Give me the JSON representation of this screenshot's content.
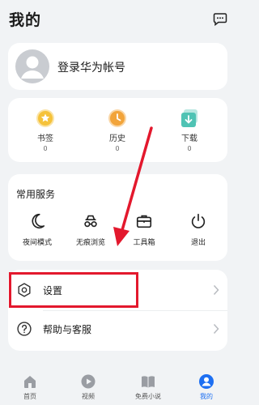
{
  "header": {
    "title": "我的"
  },
  "account": {
    "login_label": "登录华为帐号"
  },
  "stats": [
    {
      "label": "书签",
      "count": "0",
      "icon": "star-icon"
    },
    {
      "label": "历史",
      "count": "0",
      "icon": "clock-icon"
    },
    {
      "label": "下载",
      "count": "0",
      "icon": "download-icon"
    }
  ],
  "services": {
    "title": "常用服务",
    "items": [
      {
        "label": "夜间模式",
        "icon": "moon-icon"
      },
      {
        "label": "无痕浏览",
        "icon": "incognito-icon"
      },
      {
        "label": "工具箱",
        "icon": "toolbox-icon"
      },
      {
        "label": "退出",
        "icon": "power-icon"
      }
    ]
  },
  "menu": [
    {
      "label": "设置",
      "icon": "gear-icon"
    },
    {
      "label": "帮助与客服",
      "icon": "help-icon"
    }
  ],
  "tabs": [
    {
      "label": "首页",
      "icon": "home-icon",
      "active": false
    },
    {
      "label": "视频",
      "icon": "video-icon",
      "active": false
    },
    {
      "label": "免费小说",
      "icon": "book-icon",
      "active": false
    },
    {
      "label": "我的",
      "icon": "profile-icon",
      "active": true
    }
  ],
  "colors": {
    "accent": "#1d6ff2",
    "annotation": "#e3182d",
    "star": "#f5c23a",
    "clock": "#f2a43a",
    "download": "#4fc3b4"
  }
}
